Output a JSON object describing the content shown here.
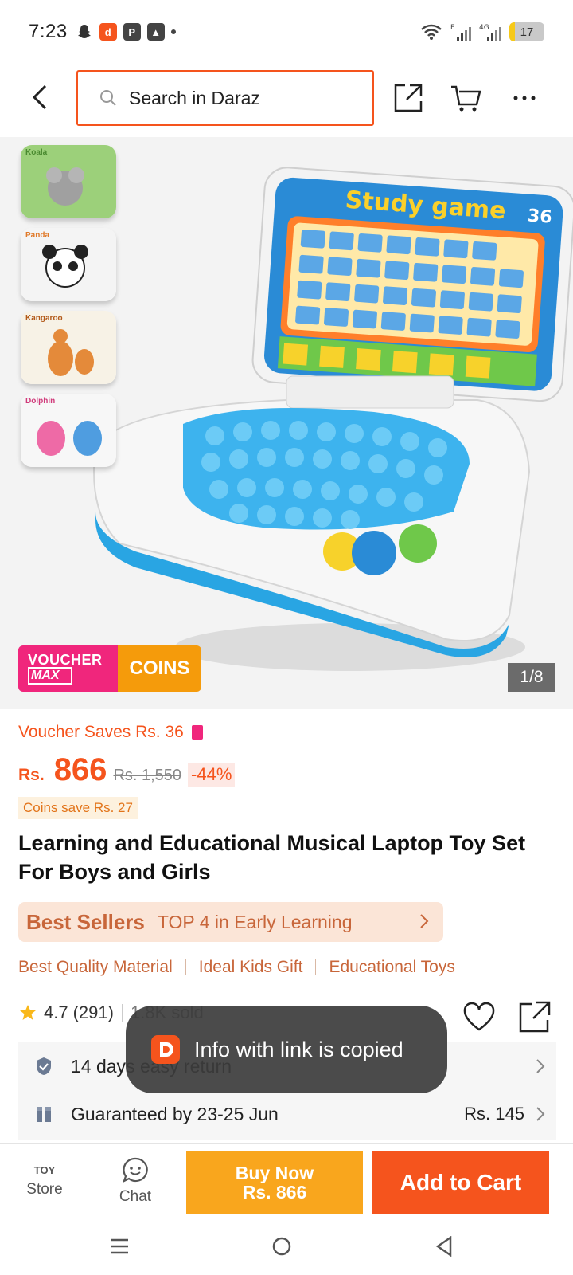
{
  "status_bar": {
    "time": "7:23",
    "battery": "17",
    "battery_fraction": 0.17,
    "network": "4G"
  },
  "header": {
    "search_placeholder": "Search in Daraz"
  },
  "gallery": {
    "image_counter": "1/8",
    "thumbnails": [
      {
        "label": "Koala"
      },
      {
        "label": "Panda"
      },
      {
        "label": "Kangaroo"
      },
      {
        "label": "Dolphin"
      }
    ],
    "badge": {
      "left_line1": "VOUCHER",
      "left_line2": "MAX",
      "right": "COINS"
    },
    "toy_screen_title": "Study game",
    "toy_badge_number": "36"
  },
  "price": {
    "voucher_saves": "Voucher Saves Rs. 36",
    "currency": "Rs.",
    "current": "866",
    "original": "Rs. 1,550",
    "discount": "-44%",
    "coins_save": "Coins save Rs. 27"
  },
  "product": {
    "title": "Learning and Educational Musical Laptop Toy Set For Boys and Girls",
    "bestseller_title": "Best Sellers",
    "bestseller_rank": "TOP 4 in Early Learning",
    "tags": [
      "Best Quality Material",
      "Ideal Kids Gift",
      "Educational Toys"
    ],
    "rating": "4.7",
    "reviews": "(291)",
    "sold": "1.8K sold"
  },
  "info": {
    "return": "14 days easy return",
    "delivery": "Guaranteed by 23-25 Jun",
    "delivery_fee": "Rs. 145"
  },
  "toast": {
    "text": "Info with link is copied"
  },
  "bottom_bar": {
    "store_label": "Store",
    "store_logo_text": "TOY",
    "chat_label": "Chat",
    "buy_now_line1": "Buy Now",
    "buy_now_line2": "Rs. 866",
    "add_to_cart": "Add to Cart"
  },
  "colors": {
    "accent": "#f5541d",
    "buy_now": "#f9a61d",
    "voucher_pink": "#f0267c",
    "coins_orange": "#f59b0b"
  }
}
